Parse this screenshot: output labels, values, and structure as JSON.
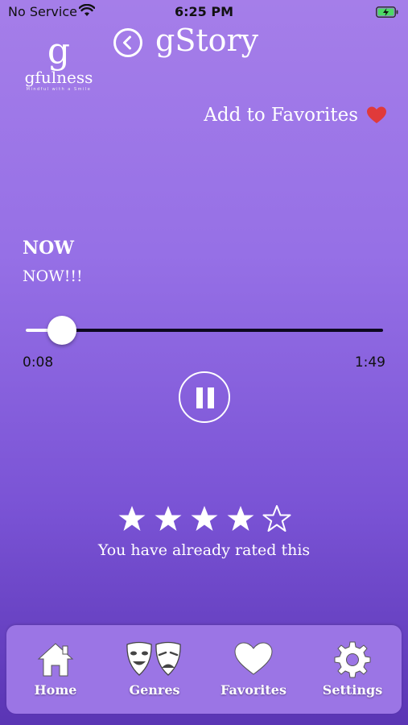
{
  "status_bar": {
    "carrier": "No Service",
    "time": "6:25 PM"
  },
  "header": {
    "logo_letter": "g",
    "logo_name": "gfulness",
    "logo_tagline": "Mindful with a Smile",
    "title": "gStory",
    "favorites_label": "Add to Favorites"
  },
  "track": {
    "title": "NOW",
    "subtitle": "NOW!!!",
    "elapsed": "0:08",
    "duration": "1:49",
    "progress_fraction": 0.073
  },
  "rating": {
    "stars_filled": 4,
    "stars_total": 5,
    "message": "You have already rated this"
  },
  "tabs": [
    {
      "label": "Home",
      "icon": "home-icon"
    },
    {
      "label": "Genres",
      "icon": "theater-masks-icon"
    },
    {
      "label": "Favorites",
      "icon": "heart-icon"
    },
    {
      "label": "Settings",
      "icon": "gear-icon"
    }
  ],
  "colors": {
    "background_top": "#a57ee9",
    "background_bottom": "#5a35b4",
    "favorite_heart": "#e03a3a",
    "tab_bar": "#9b75e5"
  }
}
